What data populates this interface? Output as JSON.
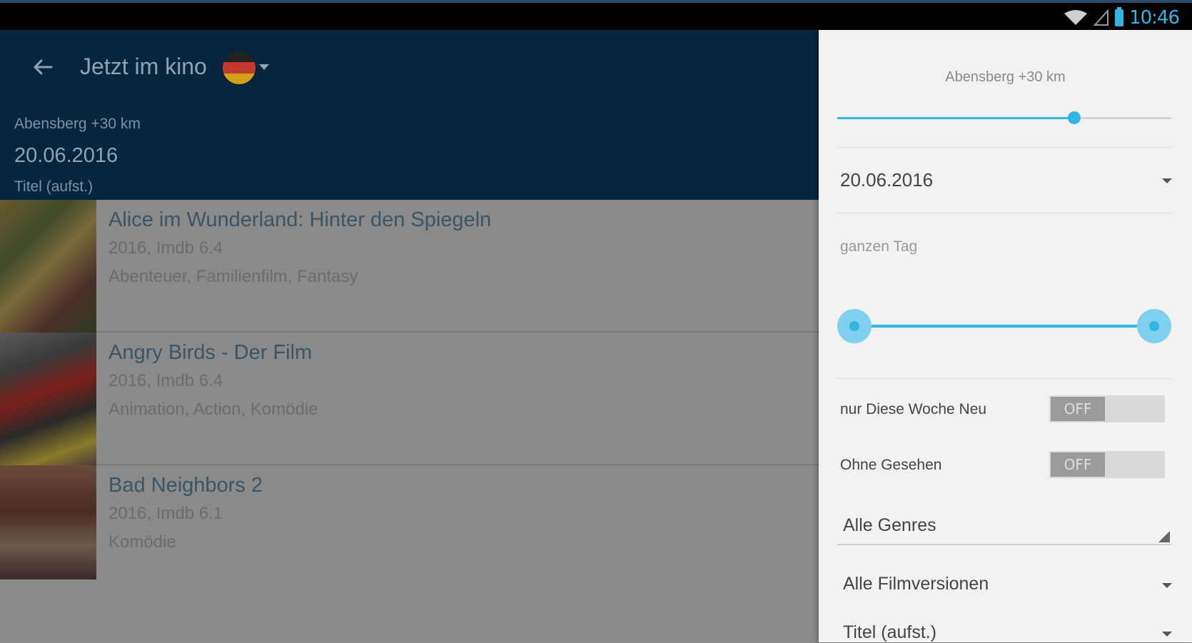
{
  "status": {
    "time": "10:46"
  },
  "appbar": {
    "title": "Jetzt im kino",
    "location": "Abensberg +30 km",
    "date": "20.06.2016",
    "sort": "Titel (aufst.)"
  },
  "movies": [
    {
      "title": "Alice im Wunderland: Hinter den Spiegeln",
      "meta": "2016, Imdb 6.4",
      "genres": "Abenteuer, Familienfilm, Fantasy"
    },
    {
      "title": "Angry Birds - Der Film",
      "meta": "2016, Imdb 6.4",
      "genres": "Animation, Action, Komödie"
    },
    {
      "title": "Bad Neighbors 2",
      "meta": "2016, Imdb 6.1",
      "genres": "Komödie"
    }
  ],
  "filters": {
    "location_label": "Abensberg +30 km",
    "radius_fraction": 0.71,
    "date": "20.06.2016",
    "time_label": "ganzen Tag",
    "time_range_fraction": [
      0.0,
      1.0
    ],
    "new_this_week_label": "nur Diese Woche Neu",
    "new_this_week_state": "OFF",
    "unseen_label": "Ohne Gesehen",
    "unseen_state": "OFF",
    "genres": "Alle Genres",
    "versions": "Alle Filmversionen",
    "sort": "Titel (aufst.)"
  },
  "colors": {
    "accent": "#33b5e5",
    "appbar": "#05263e"
  }
}
